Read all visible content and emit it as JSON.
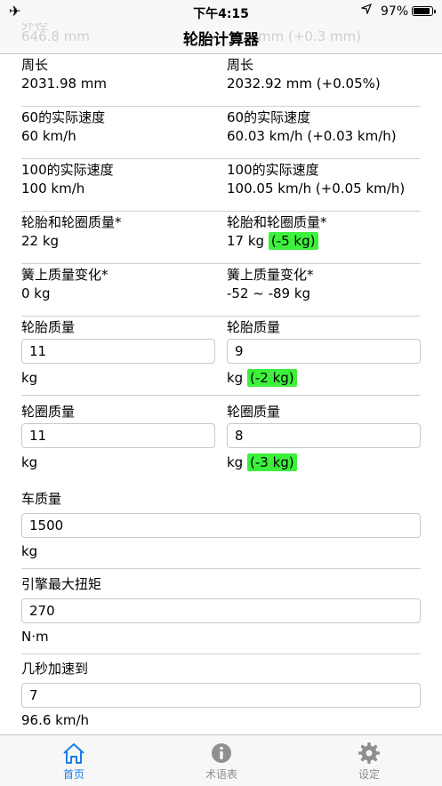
{
  "status": {
    "time": "下午4:15",
    "battery": "97%"
  },
  "nav": {
    "title": "轮胎计算器",
    "ghost_left_label": "外径",
    "ghost_left_value": "646.8 mm",
    "ghost_right_value": "mm (+0.3 mm)"
  },
  "rows": {
    "circumference": {
      "left_label": "周长",
      "left_value": "2031.98 mm",
      "right_label": "周长",
      "right_value": "2032.92 mm (+0.05%)"
    },
    "speed60": {
      "left_label": "60的实际速度",
      "left_value": "60 km/h",
      "right_label": "60的实际速度",
      "right_value": "60.03 km/h (+0.03 km/h)"
    },
    "speed100": {
      "left_label": "100的实际速度",
      "left_value": "100 km/h",
      "right_label": "100的实际速度",
      "right_value": "100.05 km/h (+0.05 km/h)"
    },
    "tire_wheel_mass": {
      "left_label": "轮胎和轮圈质量*",
      "left_value": "22 kg",
      "right_label": "轮胎和轮圈质量*",
      "right_value": "17 kg",
      "right_diff": "(-5 kg)"
    },
    "sprung_change": {
      "left_label": "簧上质量变化*",
      "left_value": "0 kg",
      "right_label": "簧上质量变化*",
      "right_value": "-52 ~ -89 kg"
    },
    "tire_mass": {
      "left_label": "轮胎质量",
      "left_input": "11",
      "left_unit": "kg",
      "right_label": "轮胎质量",
      "right_input": "9",
      "right_unit": "kg",
      "right_diff": "(-2 kg)"
    },
    "rim_mass": {
      "left_label": "轮圈质量",
      "left_input": "11",
      "left_unit": "kg",
      "right_label": "轮圈质量",
      "right_input": "8",
      "right_unit": "kg",
      "right_diff": "(-3 kg)"
    },
    "car_mass": {
      "label": "车质量",
      "input": "1500",
      "unit": "kg"
    },
    "torque": {
      "label": "引擎最大扭矩",
      "input": "270",
      "unit": "N·m"
    },
    "accel": {
      "label": "几秒加速到",
      "input": "7",
      "unit": "96.6 km/h"
    }
  },
  "tabs": [
    {
      "label": "首页",
      "icon": "home-icon",
      "active": true
    },
    {
      "label": "术语表",
      "icon": "info-icon",
      "active": false
    },
    {
      "label": "设定",
      "icon": "gear-icon",
      "active": false
    }
  ],
  "colors": {
    "accent": "#1a7ee6",
    "highlight": "#3cf03c",
    "inactive": "#8e8e93"
  }
}
